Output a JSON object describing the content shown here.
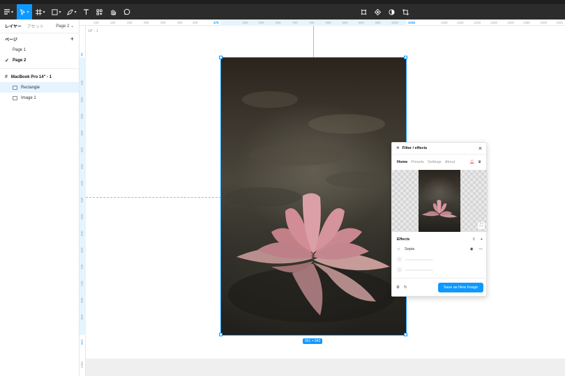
{
  "toolbar": {
    "tools": [
      "main-menu-icon",
      "move-icon",
      "frame-icon",
      "shape-icon",
      "pen-icon",
      "text-icon",
      "resources-icon",
      "hand-icon",
      "comment-icon"
    ],
    "active_tool": "move-icon",
    "center_tools": [
      "component-icon",
      "mask-icon",
      "contrast-icon",
      "crop-icon"
    ]
  },
  "left_panel": {
    "tab_layers": "レイヤー",
    "tab_assets": "アセット",
    "page_selector": "Page 2",
    "pages_heading": "ページ",
    "pages": [
      {
        "label": "Page 1",
        "current": false
      },
      {
        "label": "Page 2",
        "current": true
      }
    ],
    "layers": {
      "frame": "MacBook Pro 14\" - 1",
      "children": [
        {
          "label": "Rectangle",
          "selected": true
        },
        {
          "label": "Image 1",
          "selected": false
        }
      ]
    }
  },
  "ruler": {
    "top_ticks": [
      "100",
      "150",
      "200",
      "250",
      "300",
      "350",
      "400",
      "475",
      "550",
      "600",
      "650",
      "700",
      "750",
      "800",
      "850",
      "900",
      "950",
      "1000",
      "1036",
      "1100",
      "1150",
      "1200",
      "1250",
      "1300",
      "1350",
      "1400",
      "1450",
      "1500"
    ],
    "top_highlight": [
      "475",
      "1036"
    ],
    "left_ticks": [
      "50",
      "70",
      "150",
      "200",
      "250",
      "300",
      "350",
      "400",
      "450",
      "500",
      "550",
      "600",
      "650",
      "700",
      "750",
      "800",
      "850",
      "912",
      "1000"
    ],
    "left_highlight": [
      "70",
      "912"
    ]
  },
  "canvas": {
    "frame_label": "14\" - 1",
    "size_badge": "561 × 842"
  },
  "plugin": {
    "title": "Filter / effects",
    "tabs": [
      "Home",
      "Presets",
      "Settings",
      "About"
    ],
    "active_tab": "Home",
    "effects_heading": "Effects",
    "effects": [
      {
        "name": "Sepia",
        "visible": true
      }
    ],
    "save_button": "Save as New Image"
  },
  "colors": {
    "accent": "#0d99ff",
    "toolbar_bg": "#2c2c2c",
    "selection_bg": "#e5f4ff"
  }
}
